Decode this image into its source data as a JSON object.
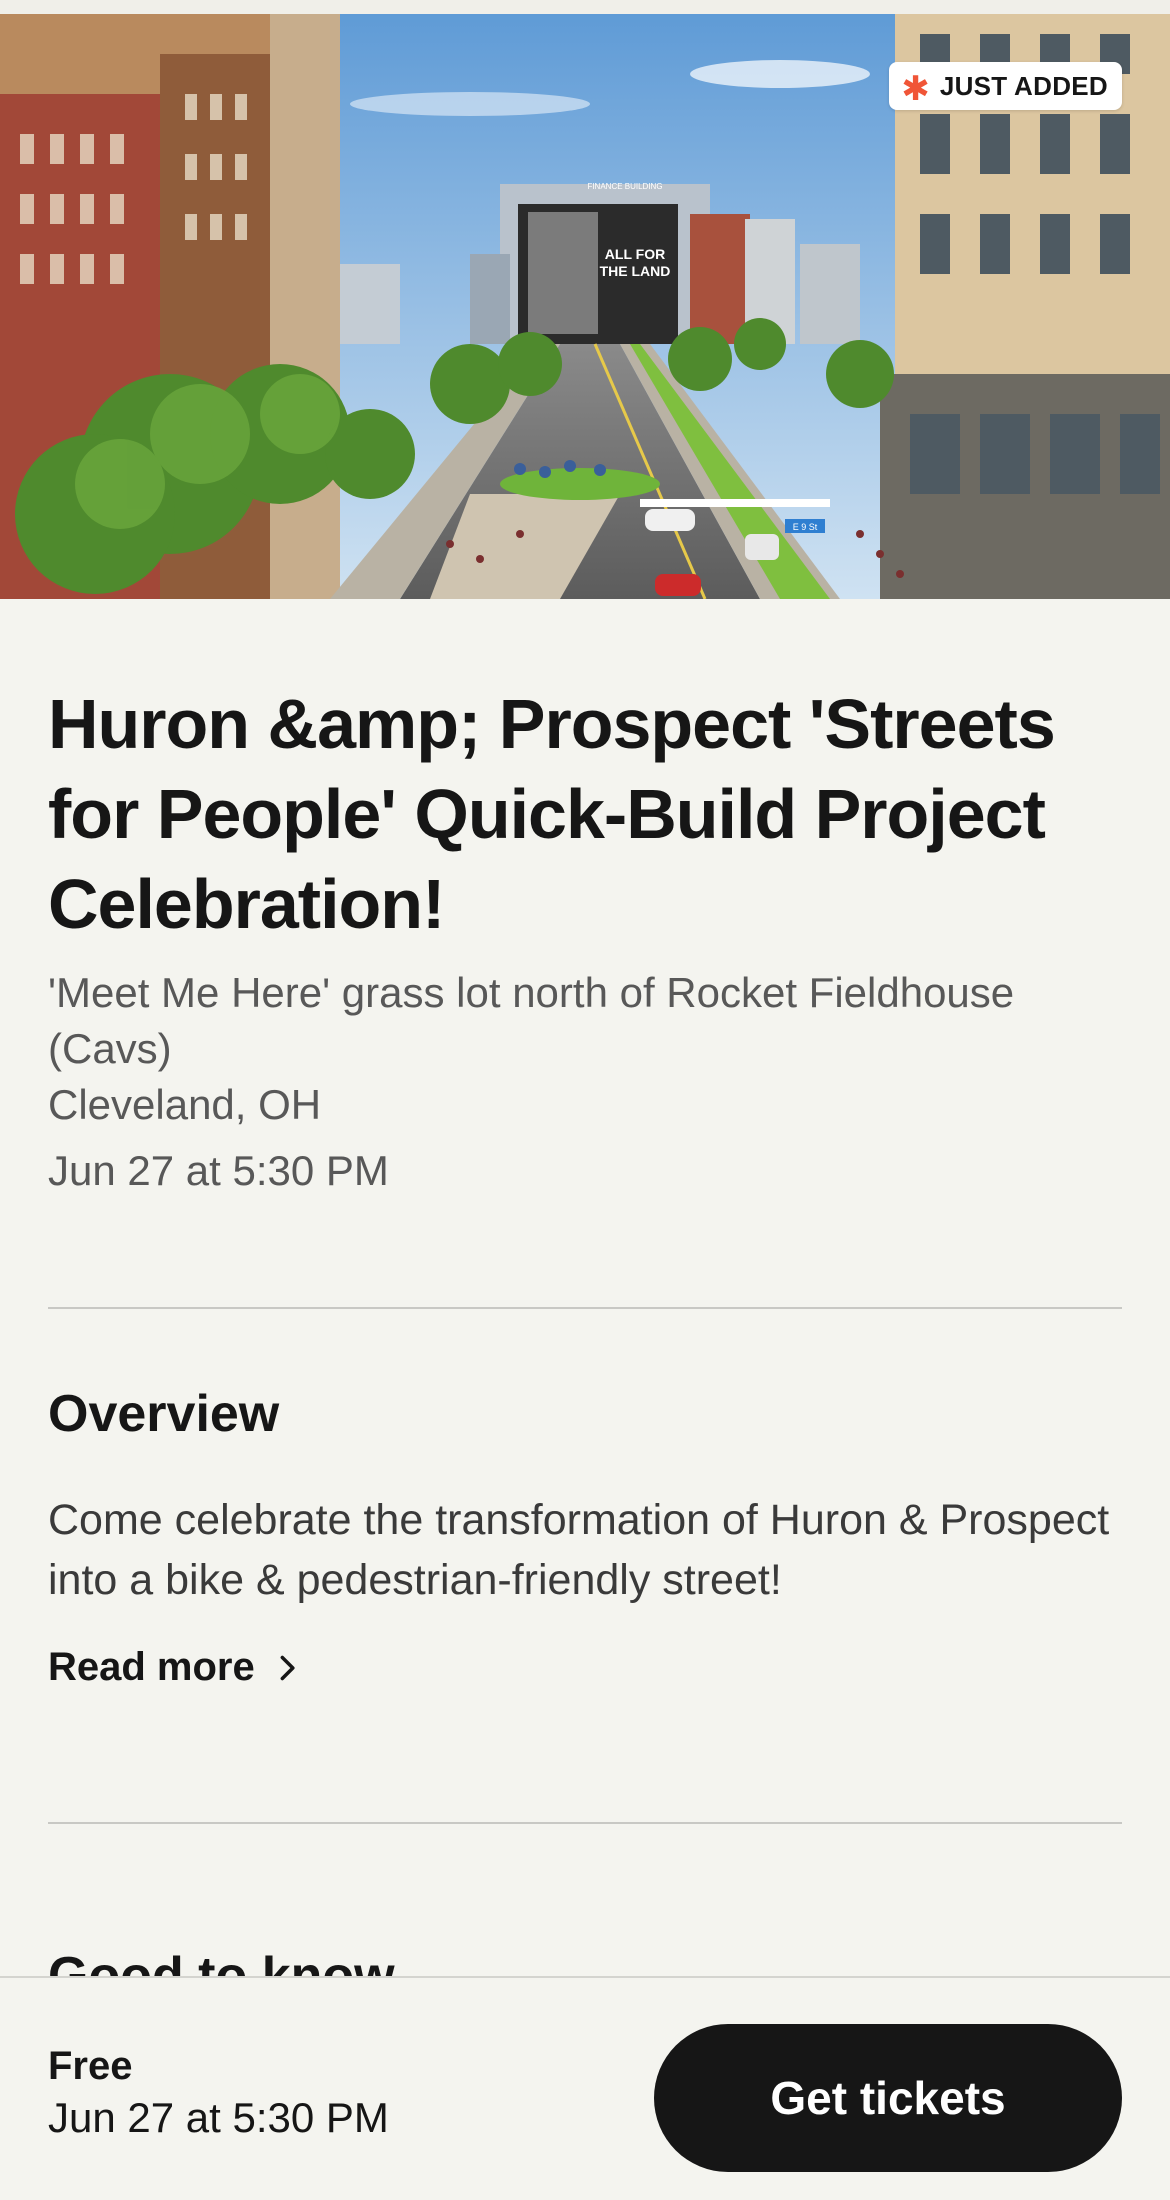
{
  "hero": {
    "badge_label": "JUST ADDED",
    "billboard_line1": "ALL FOR",
    "billboard_line2": "THE LAND",
    "building_sign": "FINANCE BUILDING",
    "street_sign": "E 9 St"
  },
  "event": {
    "title": "Huron &amp; Prospect 'Streets for People' Quick-Build Project Celebration!",
    "location": "'Meet Me Here' grass lot north of Rocket Fieldhouse (Cavs)",
    "city": "Cleveland, OH",
    "datetime": "Jun 27 at 5:30 PM"
  },
  "overview": {
    "heading": "Overview",
    "body": "Come celebrate the transformation of Huron & Prospect into a bike & pedestrian-friendly street!",
    "read_more": "Read more"
  },
  "good_to_know": {
    "heading": "Good to know"
  },
  "footer": {
    "price": "Free",
    "datetime": "Jun 27 at 5:30 PM",
    "cta": "Get tickets"
  },
  "colors": {
    "accent": "#f05537",
    "background": "#f4f4ef",
    "button": "#161616"
  }
}
